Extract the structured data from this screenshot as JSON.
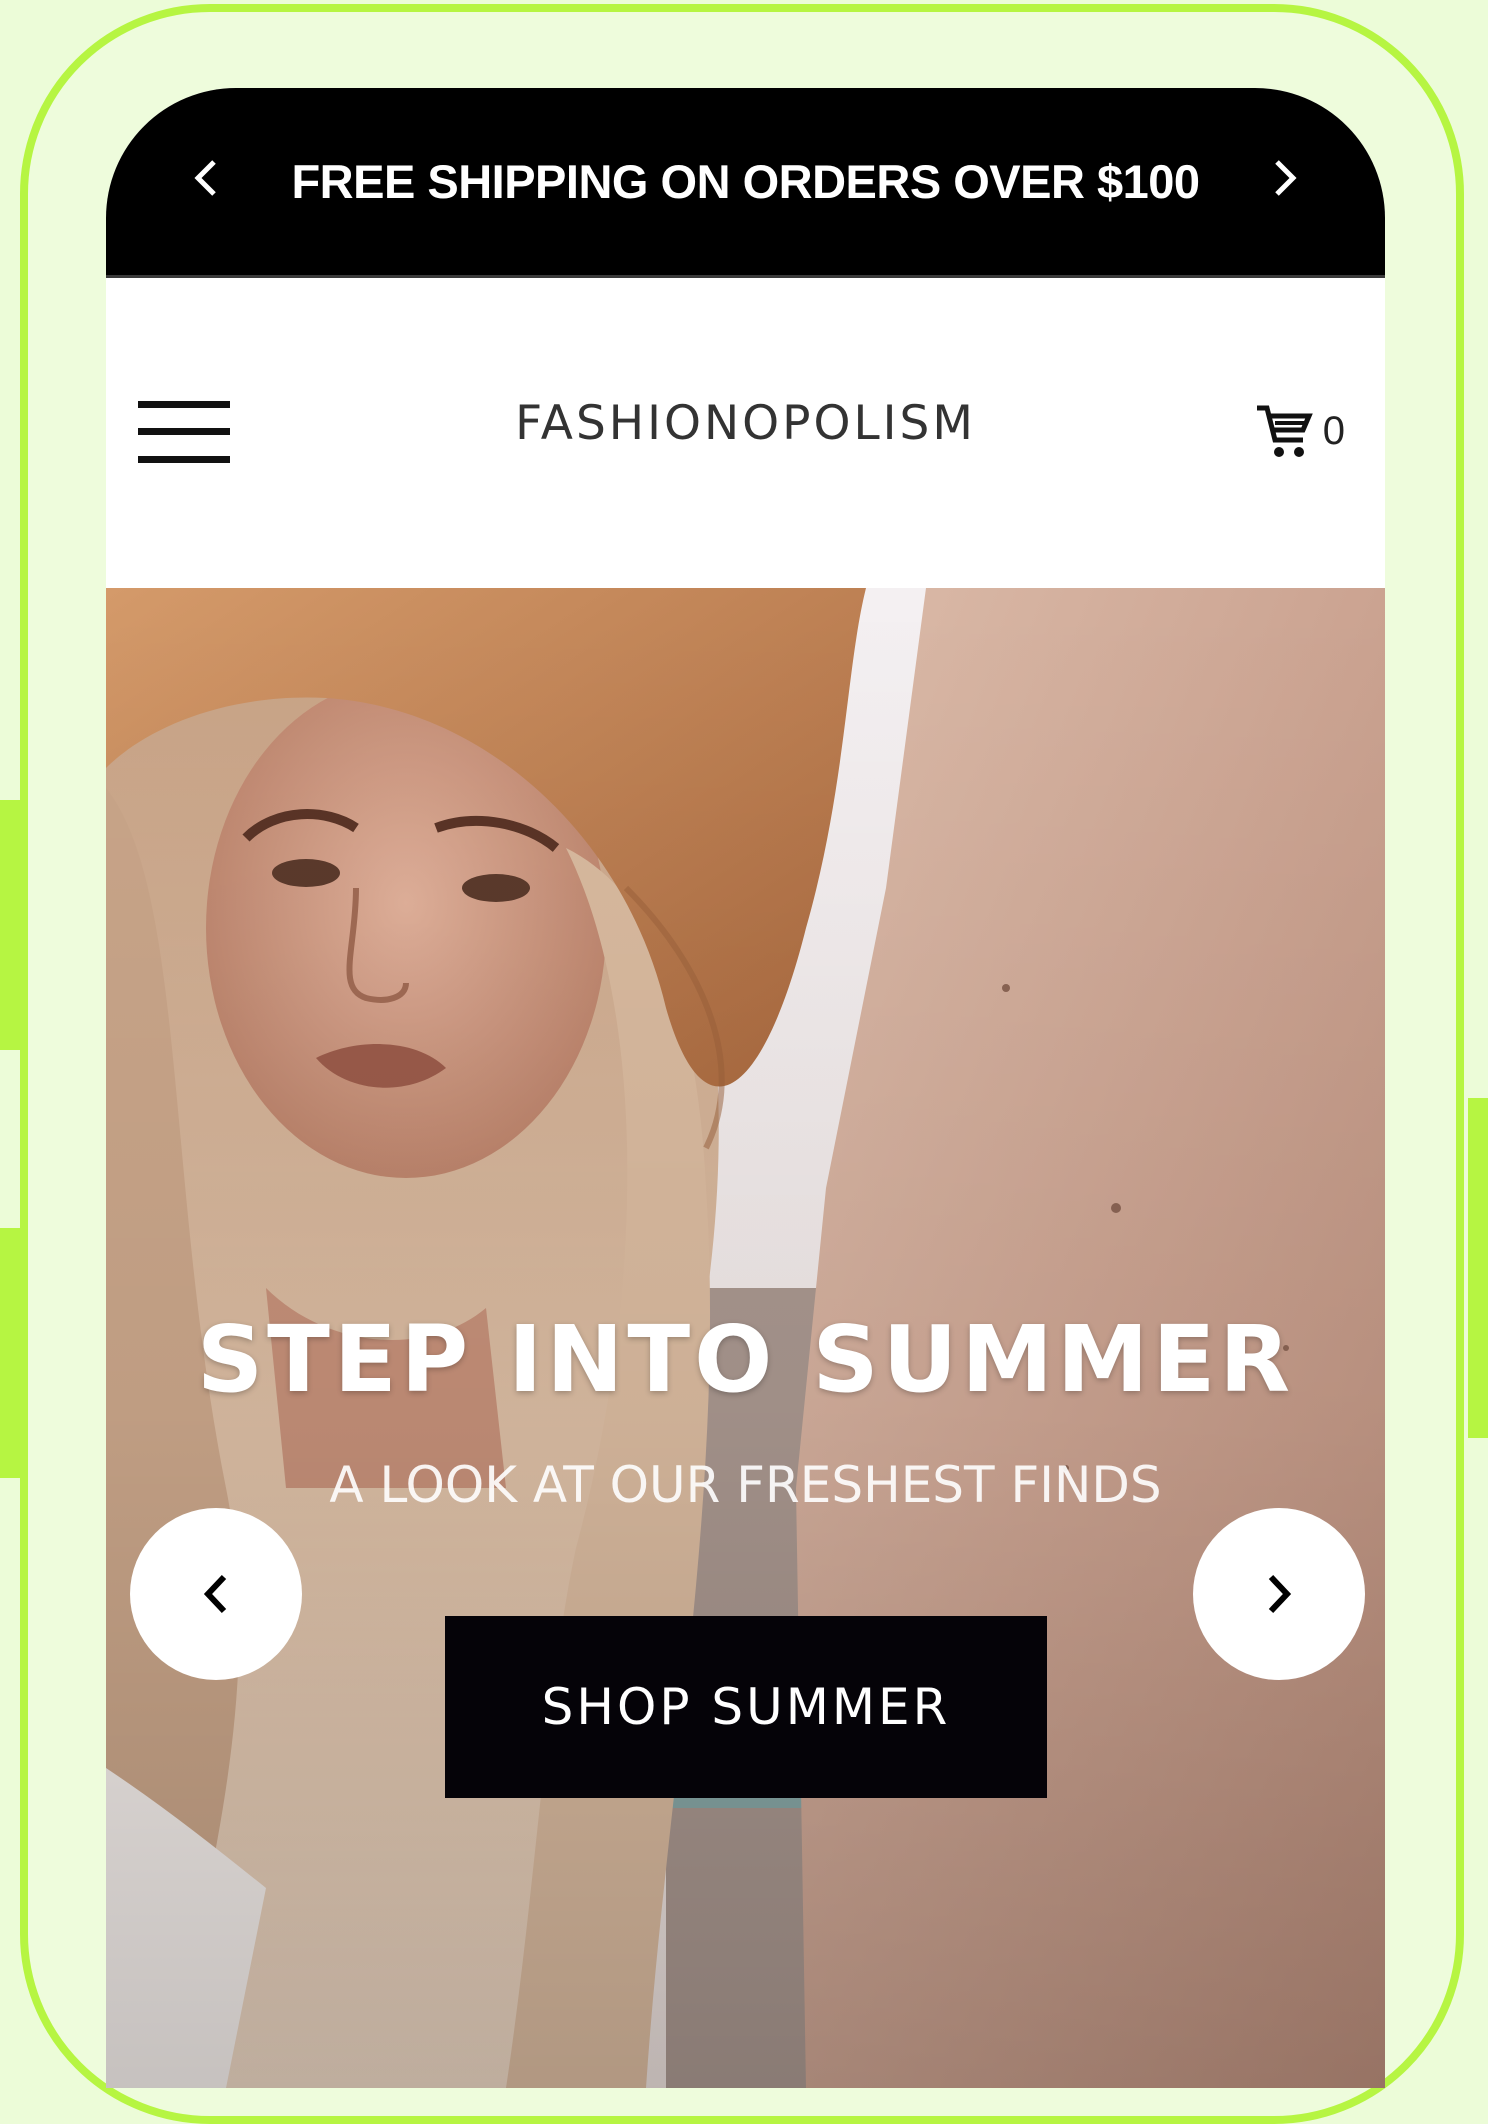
{
  "announcement": {
    "text": "FREE SHIPPING ON ORDERS OVER $100",
    "prev_icon": "chevron-left-icon",
    "next_icon": "chevron-right-icon",
    "background": "#000000",
    "color": "#ffffff"
  },
  "header": {
    "menu_icon": "hamburger-menu-icon",
    "logo": "FASHIONOPOLISM",
    "cart_icon": "cart-icon",
    "cart_count": "0"
  },
  "hero": {
    "title": "STEP INTO SUMMER",
    "subtitle": "A LOOK AT OUR FRESHEST FINDS",
    "button_label": "SHOP SUMMER",
    "prev_icon": "chevron-left-icon",
    "next_icon": "chevron-right-icon"
  },
  "colors": {
    "frame": "#b6f542",
    "backdrop": "#ecfcd8",
    "button": "#050308"
  }
}
